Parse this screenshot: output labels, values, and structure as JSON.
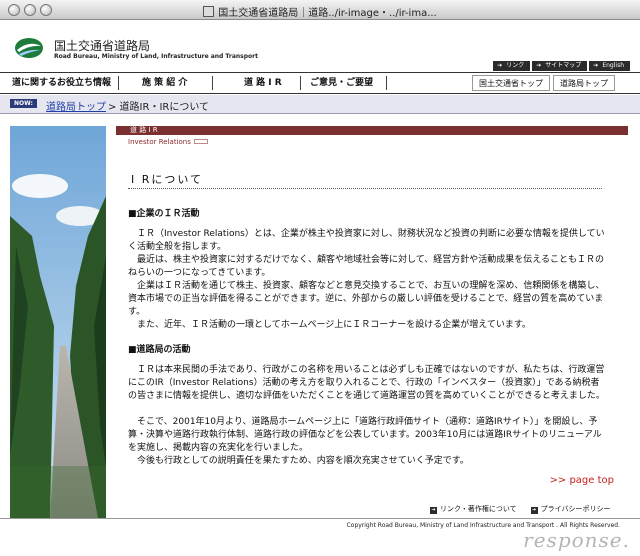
{
  "window": {
    "title": "国土交通省道路局｜道路../ir-image・../ir-ima..."
  },
  "header": {
    "org_name_jp": "国土交通省道路局",
    "org_name_en": "Road Bureau,  Ministry of Land,  Infrastructure and Transport",
    "util_links": [
      "リンク",
      "サイトマップ",
      "English"
    ]
  },
  "mainnav": {
    "items": [
      "道に関するお役立ち情報",
      "施 策 紹 介",
      "道 路 I R",
      "ご意見・ご要望"
    ],
    "right_links": [
      "国土交通省トップ",
      "道路局トップ"
    ]
  },
  "breadcrumb": {
    "now_label": "NOW:",
    "link": "道路局トップ",
    "rest": "> 道路IR・IRについて"
  },
  "content": {
    "section_bar": "道 路 I R",
    "section_sub": "Investor Relations",
    "page_heading": "I Rについて",
    "subhead1": "■企業のＩＲ活動",
    "p1": "ＩＲ（Investor Relations）とは、企業が株主や投資家に対し、財務状況など投資の判断に必要な情報を提供していく活動全般を指します。",
    "p2": "最近は、株主や投資家に対するだけでなく、顧客や地域社会等に対して、経営方針や活動成果を伝えることもＩＲのねらいの一つになってきています。",
    "p3": "企業はＩＲ活動を通じて株主、投資家、顧客などと意見交換することで、お互いの理解を深め、信頼関係を構築し、資本市場での正当な評価を得ることができます。逆に、外部からの厳しい評価を受けることで、経営の質を高めています。",
    "p4": "また、近年、ＩＲ活動の一環としてホームページ上にＩＲコーナーを設ける企業が増えています。",
    "subhead2": "■道路局の活動",
    "p5": "ＩＲは本来民間の手法であり、行政がこの名称を用いることは必ずしも正確ではないのですが、私たちは、行政運営にこのIR（Investor Relations）活動の考え方を取り入れることで、行政の「インベスター（投資家）」である納税者の皆さまに情報を提供し、適切な評価をいただくことを通じて道路運営の質を高めていくことができると考えました。",
    "p6": "そこで、2001年10月より、道路局ホームページ上に「道路行政評価サイト（通称：道路IRサイト）」を開設し、予算・決算や道路行政執行体制、道路行政の評価などを公表しています。2003年10月には道路IRサイトのリニューアルを実施し、掲載内容の充実化を行いました。",
    "p7": "今後も行政としての説明責任を果たすため、内容を順次充実させていく予定です。",
    "pagetop": ">> page top"
  },
  "footer": {
    "links": [
      "リンク・著作権について",
      "プライバシーポリシー"
    ],
    "copyright": "Copyright Road Bureau,  Ministry of Land Infrastructure and Transport . All Rights Reserved.",
    "watermark": "response."
  },
  "colors": {
    "section_bar": "#7a3030",
    "link_blue": "#1f3fa6",
    "pagetop_red": "#c8201a",
    "now_badge": "#2b3b7a"
  }
}
